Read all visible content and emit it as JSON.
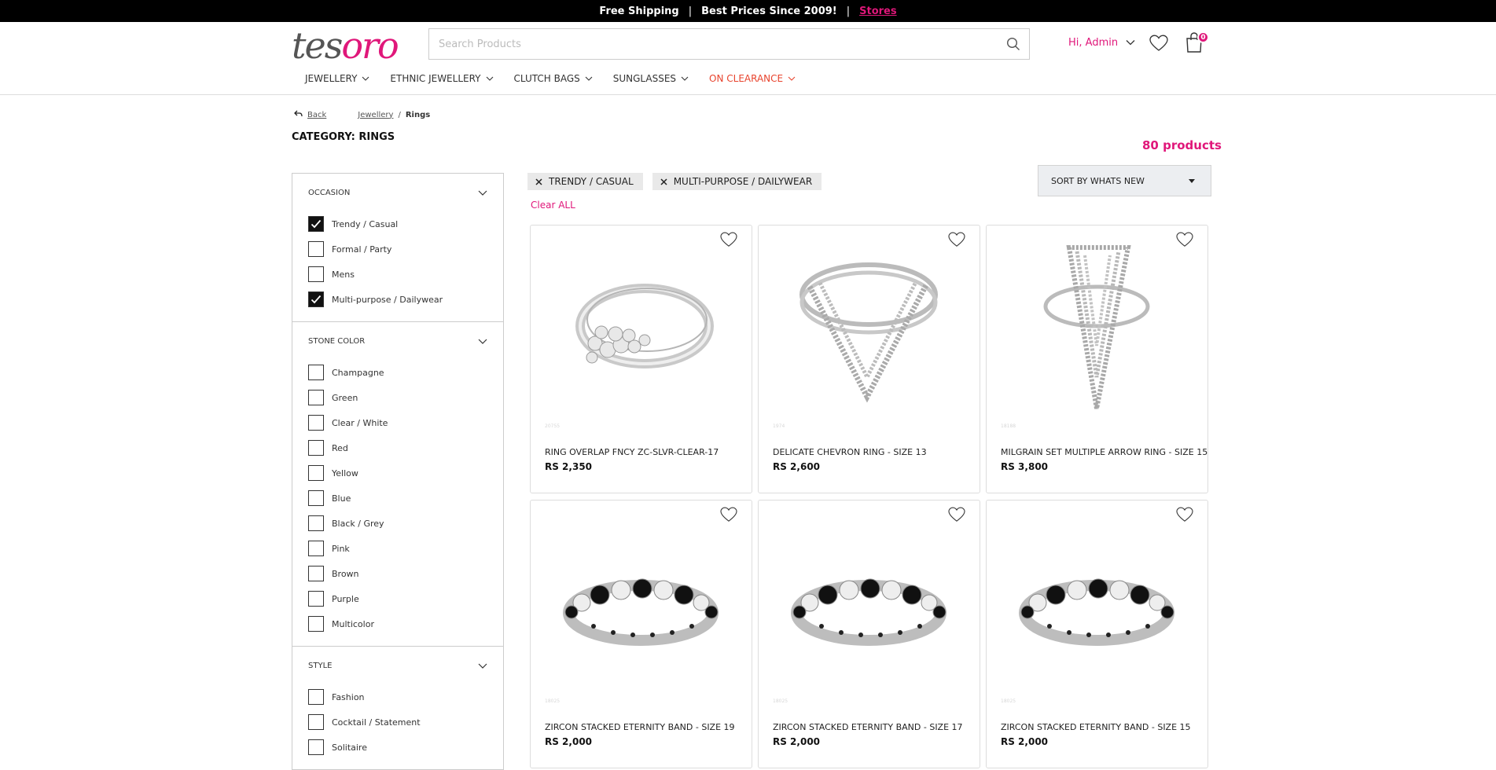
{
  "topbar": {
    "free_shipping": "Free Shipping",
    "sep1": "|",
    "best_prices": "Best Prices Since 2009!",
    "sep2": "|",
    "stores": "Stores"
  },
  "logo": {
    "part1": "tes",
    "part2": "oro"
  },
  "search": {
    "placeholder": "Search Products"
  },
  "account": {
    "greeting": "Hi, Admin",
    "cart_count": "0"
  },
  "nav": [
    {
      "label": "JEWELLERY"
    },
    {
      "label": "ETHNIC JEWELLERY"
    },
    {
      "label": "CLUTCH BAGS"
    },
    {
      "label": "SUNGLASSES"
    },
    {
      "label": "ON CLEARANCE"
    }
  ],
  "breadcrumb": {
    "back": "Back",
    "jewellery": "Jewellery",
    "sep": "/",
    "current": "Rings"
  },
  "page": {
    "title": "CATEGORY: RINGS",
    "count": "80 products"
  },
  "filters": {
    "occasion": {
      "title": "OCCASION",
      "items": [
        {
          "label": "Trendy / Casual",
          "checked": true
        },
        {
          "label": "Formal / Party",
          "checked": false
        },
        {
          "label": "Mens",
          "checked": false
        },
        {
          "label": "Multi-purpose / Dailywear",
          "checked": true
        }
      ]
    },
    "stone_color": {
      "title": "STONE COLOR",
      "items": [
        {
          "label": "Champagne"
        },
        {
          "label": "Green"
        },
        {
          "label": "Clear / White"
        },
        {
          "label": "Red"
        },
        {
          "label": "Yellow"
        },
        {
          "label": "Blue"
        },
        {
          "label": "Black / Grey"
        },
        {
          "label": "Pink"
        },
        {
          "label": "Brown"
        },
        {
          "label": "Purple"
        },
        {
          "label": "Multicolor"
        }
      ]
    },
    "style": {
      "title": "STYLE",
      "items": [
        {
          "label": "Fashion"
        },
        {
          "label": "Cocktail / Statement"
        },
        {
          "label": "Solitaire"
        }
      ]
    }
  },
  "chips": [
    {
      "label": "TRENDY / CASUAL"
    },
    {
      "label": "MULTI-PURPOSE / DAILYWEAR"
    }
  ],
  "clear_all": "Clear ALL",
  "sort": {
    "label": "SORT BY WHATS NEW"
  },
  "products": [
    {
      "name": "RING OVERLAP FNCY ZC-SLVR-CLEAR-17",
      "price": "RS 2,350",
      "sku": "20755"
    },
    {
      "name": "DELICATE CHEVRON RING - SIZE 13",
      "price": "RS 2,600",
      "sku": "1974"
    },
    {
      "name": "MILGRAIN SET MULTIPLE ARROW RING - SIZE 15",
      "price": "RS 3,800",
      "sku": "18188"
    },
    {
      "name": "ZIRCON STACKED ETERNITY BAND - SIZE 19",
      "price": "RS 2,000",
      "sku": "18025"
    },
    {
      "name": "ZIRCON STACKED ETERNITY BAND - SIZE 17",
      "price": "RS 2,000",
      "sku": "18025"
    },
    {
      "name": "ZIRCON STACKED ETERNITY BAND - SIZE 15",
      "price": "RS 2,000",
      "sku": "18025"
    }
  ],
  "colors": {
    "accent": "#e0177a",
    "clearance": "#e8442e",
    "topbar": "#000000"
  }
}
